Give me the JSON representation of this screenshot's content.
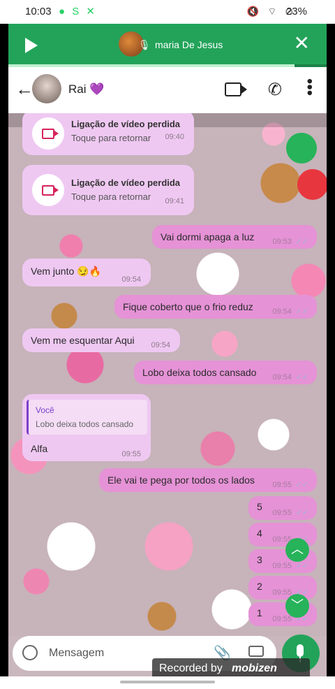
{
  "status_bar": {
    "time": "10:03",
    "battery": "23%"
  },
  "call_banner": {
    "caller_name": "maria De Jesus"
  },
  "header": {
    "contact_name": "Rai 💜"
  },
  "messages": [
    {
      "type": "missed_call",
      "title": "Ligação de vídeo perdida",
      "subtitle": "Toque para retornar",
      "time": "09:40"
    },
    {
      "type": "missed_call",
      "title": "Ligação de vídeo perdida",
      "subtitle": "Toque para retornar",
      "time": "09:41"
    },
    {
      "type": "out",
      "text": "Vai dormi  apaga a luz",
      "time": "09:53"
    },
    {
      "type": "in",
      "text": "Vem junto 😏🔥",
      "time": "09:54"
    },
    {
      "type": "out",
      "text": "Fique coberto que o frio reduz",
      "time": "09:54"
    },
    {
      "type": "in",
      "text": "Vem me esquentar Aqui",
      "time": "09:54"
    },
    {
      "type": "out",
      "text": "Lobo deixa todos cansado",
      "time": "09:54"
    },
    {
      "type": "in_reply",
      "quote_author": "Você",
      "quote_text": "Lobo deixa todos cansado",
      "text": "Alfa",
      "time": "09:55"
    },
    {
      "type": "out",
      "text": "Ele vai te pega por todos os lados",
      "time": "09:55"
    },
    {
      "type": "out",
      "text": "5",
      "time": "09:55"
    },
    {
      "type": "out",
      "text": "4",
      "time": "09:55"
    },
    {
      "type": "out",
      "text": "3",
      "time": "09:55"
    },
    {
      "type": "out",
      "text": "2",
      "time": "09:55"
    },
    {
      "type": "out",
      "text": "1",
      "time": "09:55"
    }
  ],
  "composer": {
    "placeholder": "Mensagem"
  },
  "overlay": {
    "recorded_prefix": "Recorded by",
    "recorder_brand": "mobizen"
  },
  "colors": {
    "accent": "#23a35a",
    "incoming": "#efc8f2",
    "outgoing": "#e592d6"
  }
}
